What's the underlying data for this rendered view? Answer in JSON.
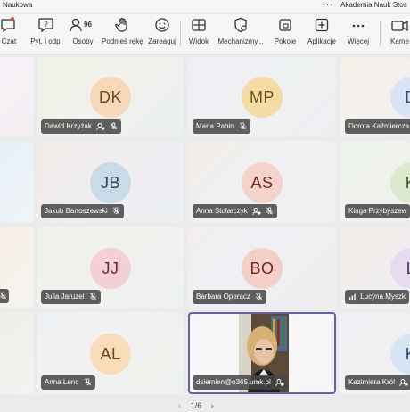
{
  "window": {
    "title_left": "Naukowa",
    "more": "···",
    "title_right": "Akademia Nauk Stos"
  },
  "toolbar": {
    "chat": "Czat",
    "qa": "Pyt. i odp.",
    "people": "Osoby",
    "people_count": "96",
    "raise_hand": "Podnieś rękę",
    "react": "Zareaguj",
    "view": "Widok",
    "mechanisms": "Mechanizmy...",
    "rooms": "Pokoje",
    "apps": "Aplikacje",
    "more": "Więcej",
    "camera": "Kame"
  },
  "participants": {
    "r1c1": {
      "initials": "DK",
      "name": "Dawid Krzyżak"
    },
    "r1c2": {
      "initials": "MP",
      "name": "Maria Pabin"
    },
    "r1c3": {
      "initials": "D",
      "name": "Dorota Kaźmiercza"
    },
    "r2c1": {
      "initials": "JB",
      "name": "Jakub Bartoszewski"
    },
    "r2c2": {
      "initials": "AS",
      "name": "Anna Stolarczyk"
    },
    "r2c3": {
      "initials": "K",
      "name": "Kinga Przybyszew"
    },
    "r3c1": {
      "initials": "JJ",
      "name": "Julia Jaruzel"
    },
    "r3c2": {
      "initials": "BO",
      "name": "Barbara Operacz"
    },
    "r3c3": {
      "initials": "L",
      "name": "Lucyna Myszk"
    },
    "r4c1": {
      "initials": "AL",
      "name": "Anna Lenc"
    },
    "r4c2": {
      "name": "dsiemien@o365.umk.pl"
    },
    "r4c3": {
      "initials": "K",
      "name": "Kazimiera Król"
    }
  },
  "pager": {
    "prev": "‹",
    "text": "1/6",
    "next": "›"
  },
  "colors": {
    "accent": "#6264a7",
    "badge": "#e04b3c",
    "nametag_bg": "#464646"
  }
}
